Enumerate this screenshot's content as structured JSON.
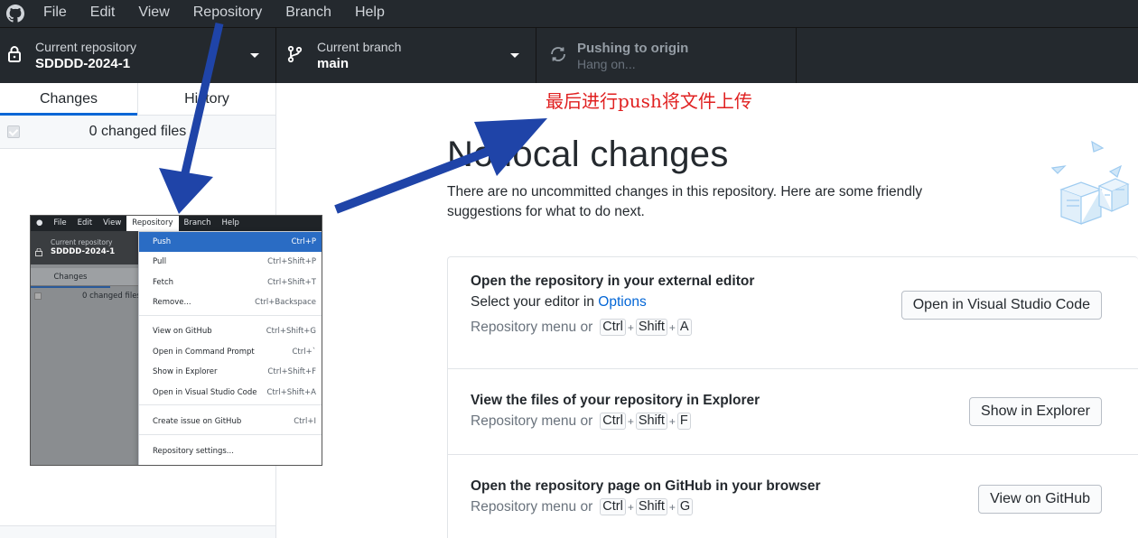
{
  "menubar": {
    "items": [
      "File",
      "Edit",
      "View",
      "Repository",
      "Branch",
      "Help"
    ]
  },
  "toolbar": {
    "repo_label": "Current repository",
    "repo_value": "SDDDD-2024-1",
    "branch_label": "Current branch",
    "branch_value": "main",
    "push_label": "Pushing to origin",
    "push_value": "Hang on..."
  },
  "sidebar": {
    "tabs": [
      "Changes",
      "History"
    ],
    "changed_files": "0 changed files"
  },
  "annotation": "最后进行push将文件上传",
  "main": {
    "title": "No local changes",
    "subtitle": "There are no uncommitted changes in this repository. Here are some friendly suggestions for what to do next.",
    "cards": [
      {
        "title": "Open the repository in your external editor",
        "line_prefix": "Select your editor in ",
        "line_link": "Options",
        "hint": "Repository menu or",
        "keys": [
          "Ctrl",
          "Shift",
          "A"
        ],
        "button": "Open in Visual Studio Code"
      },
      {
        "title": "View the files of your repository in Explorer",
        "hint": "Repository menu or",
        "keys": [
          "Ctrl",
          "Shift",
          "F"
        ],
        "button": "Show in Explorer"
      },
      {
        "title": "Open the repository page on GitHub in your browser",
        "hint": "Repository menu or",
        "keys": [
          "Ctrl",
          "Shift",
          "G"
        ],
        "button": "View on GitHub"
      }
    ]
  },
  "inset": {
    "menubar": [
      "File",
      "Edit",
      "View",
      "Repository",
      "Branch",
      "Help"
    ],
    "repo_label": "Current repository",
    "repo_value": "SDDDD-2024-1",
    "tab": "Changes",
    "changed": "0 changed files",
    "dropdown": [
      {
        "label": "Push",
        "shortcut": "Ctrl+P"
      },
      {
        "label": "Pull",
        "shortcut": "Ctrl+Shift+P"
      },
      {
        "label": "Fetch",
        "shortcut": "Ctrl+Shift+T"
      },
      {
        "label": "Remove...",
        "shortcut": "Ctrl+Backspace"
      },
      {
        "label": "View on GitHub",
        "shortcut": "Ctrl+Shift+G"
      },
      {
        "label": "Open in Command Prompt",
        "shortcut": "Ctrl+`"
      },
      {
        "label": "Show in Explorer",
        "shortcut": "Ctrl+Shift+F"
      },
      {
        "label": "Open in Visual Studio Code",
        "shortcut": "Ctrl+Shift+A"
      },
      {
        "label": "Create issue on GitHub",
        "shortcut": "Ctrl+I"
      },
      {
        "label": "Repository settings...",
        "shortcut": ""
      }
    ]
  },
  "colors": {
    "toolbar_bg": "#24292e",
    "accent": "#0366d6",
    "highlight": "#2a6cc4",
    "arrow": "#1f44a8",
    "annotation": "#e02020"
  },
  "icons": {
    "app_logo": "github-icon",
    "repo": "lock-icon",
    "branch": "git-branch-icon",
    "push": "sync-icon",
    "dropdown": "chevron-down-icon"
  }
}
